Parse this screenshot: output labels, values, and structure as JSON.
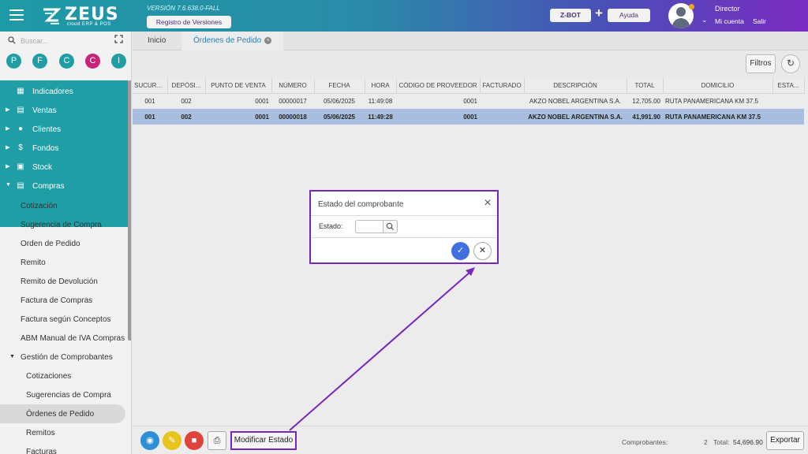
{
  "header": {
    "logo_text": "ZEUS",
    "logo_sub": "cloud ERP & POS",
    "version": "VERSIÓN 7.6.638.0-FALL",
    "registro_label": "Registro de Versiones",
    "zbot_label": "Z-BOT",
    "plus": "+",
    "ayuda_label": "Ayuda",
    "user_name": "Director",
    "mi_cuenta": "Mi cuenta",
    "salir": "Salir",
    "gradient_start": "#1d9aa5",
    "gradient_end": "#7a2bc0"
  },
  "sidebar": {
    "search_placeholder": "Buscar...",
    "circles": [
      {
        "letter": "P",
        "color": "#1f9ea5"
      },
      {
        "letter": "F",
        "color": "#1f9ea5"
      },
      {
        "letter": "C",
        "color": "#1f9ea5"
      },
      {
        "letter": "C",
        "color": "#c8247a"
      },
      {
        "letter": "I",
        "color": "#1f9ea5"
      }
    ],
    "main_items": [
      {
        "label": "Indicadores",
        "icon": "grid-icon"
      },
      {
        "label": "Ventas",
        "icon": "cart-icon"
      },
      {
        "label": "Clientes",
        "icon": "people-icon"
      },
      {
        "label": "Fondos",
        "icon": "dollar-icon"
      },
      {
        "label": "Stock",
        "icon": "box-icon"
      },
      {
        "label": "Compras",
        "icon": "shopping-cart-icon"
      }
    ],
    "compras_items": [
      "Cotización",
      "Sugerencia de Compra",
      "Orden de Pedido",
      "Remito",
      "Remito de Devolución",
      "Factura de Compras",
      "Factura según Conceptos",
      "ABM Manual de IVA Compras",
      "Gestión de Comprobantes"
    ],
    "gestion_items": [
      "Cotizaciones",
      "Sugerencias de Compra",
      "Órdenes de Pedido",
      "Remitos",
      "Facturas"
    ],
    "teal_color": "#1f9ea5"
  },
  "tabs": [
    {
      "label": "Inicio"
    },
    {
      "label": "Órdenes de Pedido"
    }
  ],
  "toolbar": {
    "filtros_label": "Filtros",
    "refresh_icon": "refresh-icon"
  },
  "grid": {
    "columns": [
      "SUCURS...",
      "DEPÓSI...",
      "PUNTO DE VENTA",
      "NÚMERO",
      "FECHA",
      "HORA",
      "CÓDIGO DE PROVEEDOR",
      "FACTURADO",
      "DESCRIPCIÓN",
      "TOTAL",
      "DOMICILIO",
      "ESTA..."
    ],
    "rows": [
      [
        "001",
        "002",
        "0001",
        "00000017",
        "05/06/2025",
        "11:49:08",
        "0001",
        "",
        "AKZO NOBEL ARGENTINA S.A.",
        "12,705.00",
        "RUTA PANAMERICANA KM 37.5",
        ""
      ],
      [
        "001",
        "002",
        "0001",
        "00000018",
        "05/06/2025",
        "11:49:28",
        "0001",
        "",
        "AKZO NOBEL ARGENTINA S.A.",
        "41,991.90",
        "RUTA PANAMERICANA KM 37.5",
        ""
      ]
    ],
    "selected_row_color": "#a9bedf"
  },
  "bottombar": {
    "modificar_label": "Modificar Estado",
    "comprobantes_label": "Comprobantes:",
    "comprobantes_count": "2",
    "total_label": "Total:",
    "total_value": "54,696.90",
    "exportar_label": "Exportar",
    "view_color": "#2f8fd6",
    "edit_color": "#e8c51a",
    "delete_color": "#e0433a"
  },
  "modal": {
    "title": "Estado del comprobante",
    "estado_label": "Estado:",
    "estado_value": "",
    "accent": "#7a26b8"
  }
}
